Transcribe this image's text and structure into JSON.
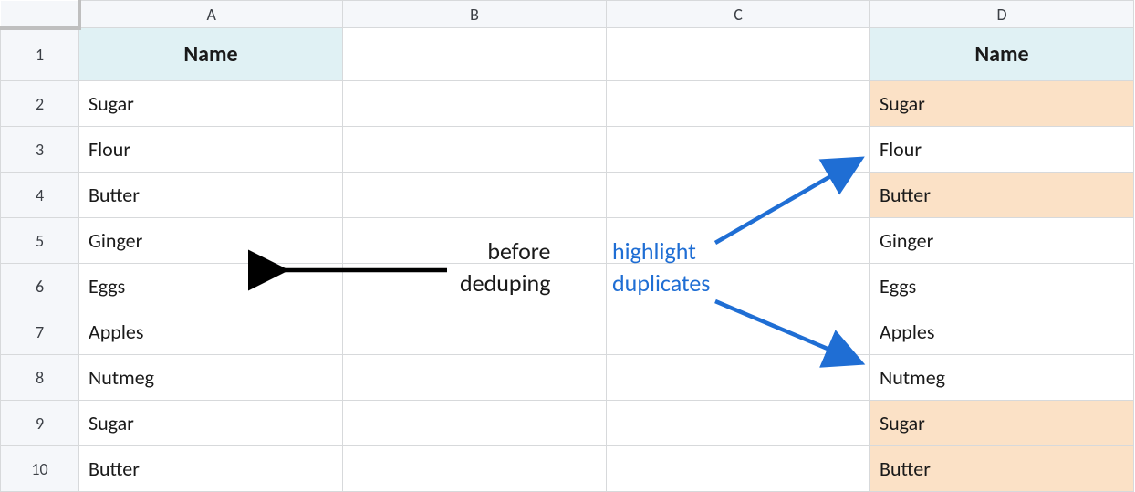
{
  "columns": [
    "A",
    "B",
    "C",
    "D"
  ],
  "rowNumbers": [
    1,
    2,
    3,
    4,
    5,
    6,
    7,
    8,
    9,
    10
  ],
  "colA_header": "Name",
  "colA_values": [
    "Sugar",
    "Flour",
    "Butter",
    "Ginger",
    "Eggs",
    "Apples",
    "Nutmeg",
    "Sugar",
    "Butter"
  ],
  "colD_header": "Name",
  "colD_values": [
    "Sugar",
    "Flour",
    "Butter",
    "Ginger",
    "Eggs",
    "Apples",
    "Nutmeg",
    "Sugar",
    "Butter"
  ],
  "colD_highlight": [
    true,
    false,
    true,
    false,
    false,
    false,
    false,
    true,
    true
  ],
  "annotation_before_line1": "before",
  "annotation_before_line2": "deduping",
  "annotation_highlight_line1": "highlight",
  "annotation_highlight_line2": "duplicates",
  "colors": {
    "headerFill": "#e0f1f4",
    "duplicateFill": "#fbe1c6",
    "arrowBlack": "#000000",
    "arrowBlue": "#1f6ed4"
  }
}
